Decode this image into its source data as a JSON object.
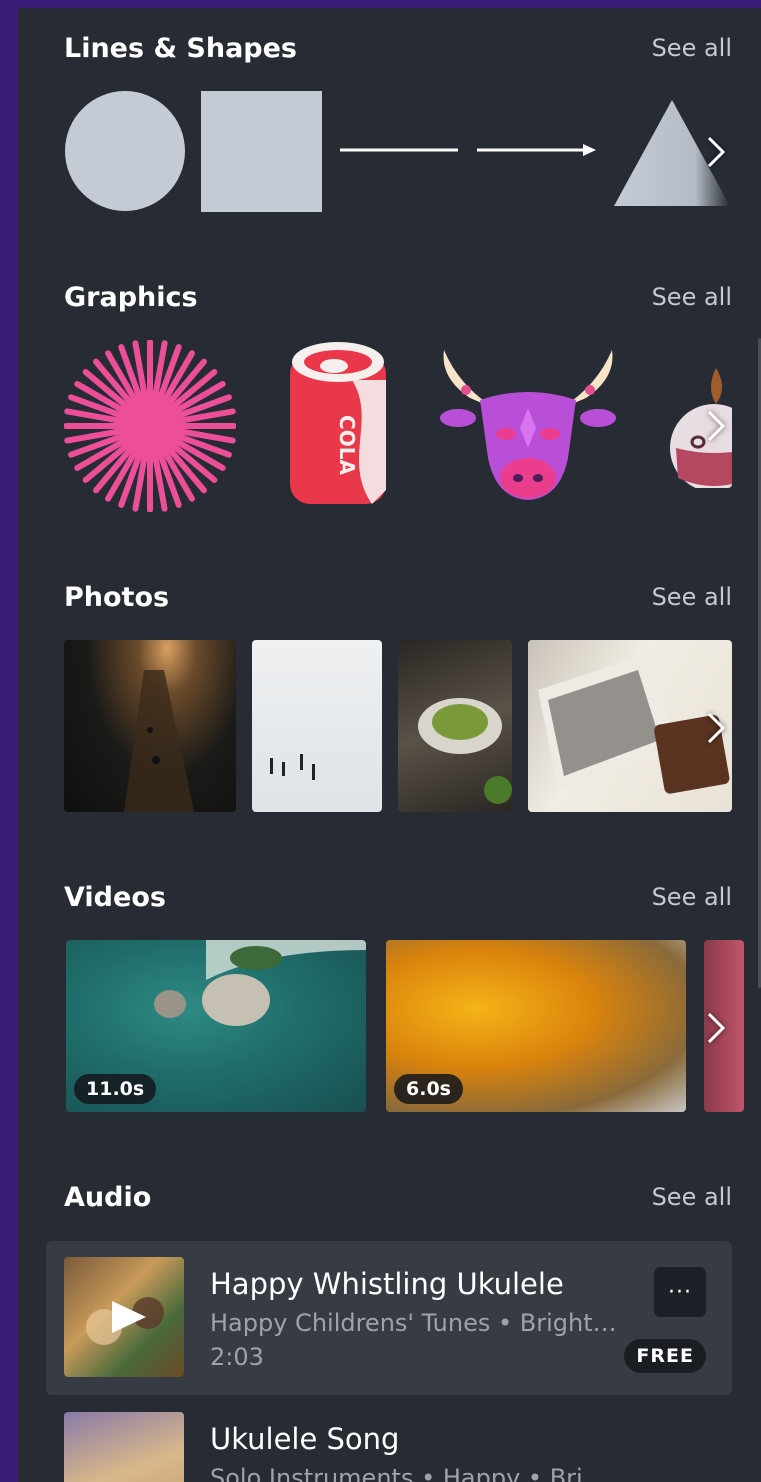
{
  "sections": {
    "shapes": {
      "title": "Lines & Shapes",
      "see_all": "See all"
    },
    "graphics": {
      "title": "Graphics",
      "see_all": "See all"
    },
    "photos": {
      "title": "Photos",
      "see_all": "See all"
    },
    "videos": {
      "title": "Videos",
      "see_all": "See all"
    },
    "audio": {
      "title": "Audio",
      "see_all": "See all"
    }
  },
  "graphics": {
    "cola_text": "COLA"
  },
  "videos": [
    {
      "duration": "11.0s"
    },
    {
      "duration": "6.0s"
    }
  ],
  "audio": [
    {
      "title": "Happy Whistling Ukulele",
      "subtitle": "Happy Childrens' Tunes • Bright ...",
      "duration": "2:03",
      "badge": "FREE",
      "more": "···"
    },
    {
      "title": "Ukulele Song",
      "subtitle": "Solo Instruments • Happy • Bright"
    }
  ],
  "icons": {
    "next": "chevron-right-icon",
    "play": "play-icon",
    "more": "more-horizontal-icon"
  },
  "colors": {
    "panel_bg": "#272b33",
    "outer_bg": "#3a1c78",
    "shape_fill": "#c4cbd4",
    "card_bg": "#373b44"
  }
}
